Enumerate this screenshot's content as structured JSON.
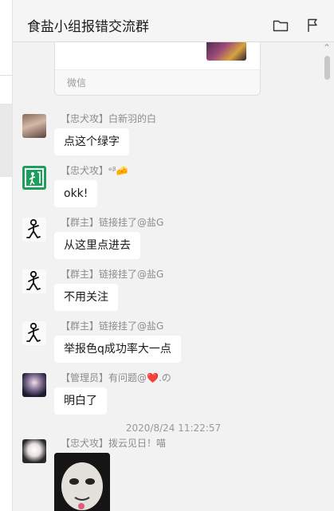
{
  "window": {
    "title": "食盐小组报错交流群",
    "icons": [
      "folder-icon",
      "flag-icon"
    ]
  },
  "card": {
    "source_label": "微信"
  },
  "messages": [
    {
      "sender": "【忠犬攻】白新羽的白",
      "text": "点这个绿字",
      "avatar": "girl-photo"
    },
    {
      "sender": "【忠犬攻】ᵉᵝ🧀",
      "text": "okk!",
      "avatar": "green-icon"
    },
    {
      "sender": "【群主】链接挂了@盐G",
      "text": "从这里点进去",
      "avatar": "stick-figure"
    },
    {
      "sender": "【群主】链接挂了@盐G",
      "text": "不用关注",
      "avatar": "stick-figure"
    },
    {
      "sender": "【群主】链接挂了@盐G",
      "text": "举报色q成功率大一点",
      "avatar": "stick-figure"
    },
    {
      "sender": "【管理员】有问题@❤️.の",
      "text": "明白了",
      "avatar": "anime-girl"
    }
  ],
  "timestamp": "2020/8/24 11:22:57",
  "last_message": {
    "sender": "【忠犬攻】拨云见日！喵",
    "avatar": "anime-girl-2"
  },
  "colors": {
    "background": "#f2f2f2",
    "bubble": "#ffffff",
    "header": "#f5f5f5"
  }
}
